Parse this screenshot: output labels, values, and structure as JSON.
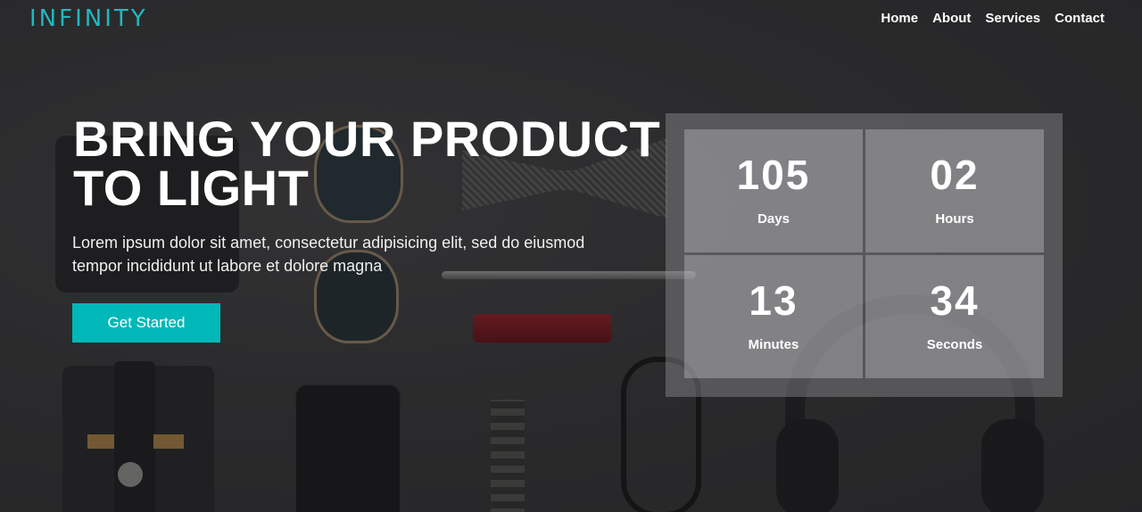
{
  "brand": {
    "logo_text": "INFINITY",
    "accent_color": "#1fb9bf"
  },
  "nav": {
    "items": [
      "Home",
      "About",
      "Services",
      "Contact"
    ]
  },
  "hero": {
    "headline_line1": "BRING YOUR PRODUCT",
    "headline_line2": "TO LIGHT",
    "lead_line1": "Lorem ipsum dolor sit amet, consectetur adipisicing elit, sed do eiusmod",
    "lead_line2": "tempor incididunt ut labore et dolore magna",
    "cta_label": "Get Started",
    "cta_color": "#00b8b8"
  },
  "countdown": {
    "days": {
      "value": "105",
      "label": "Days"
    },
    "hours": {
      "value": "02",
      "label": "Hours"
    },
    "minutes": {
      "value": "13",
      "label": "Minutes"
    },
    "seconds": {
      "value": "34",
      "label": "Seconds"
    }
  }
}
